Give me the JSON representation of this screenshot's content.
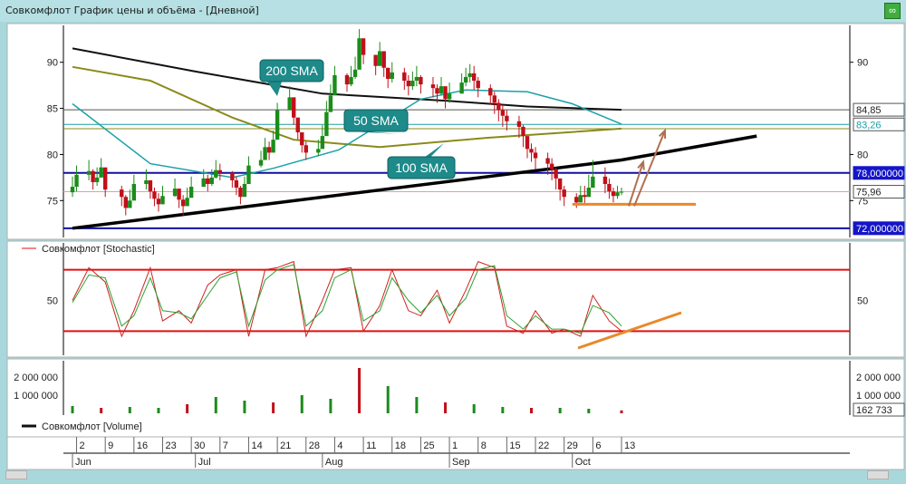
{
  "window": {
    "title": "Совкомфлот График цены и объёма - [Дневной]",
    "link_icon": "link-icon"
  },
  "colors": {
    "background": "#ffffff",
    "candle_up": "#1a8c1a",
    "candle_down": "#c0101a",
    "sma200": "#111111",
    "sma100": "#8a8a1a",
    "sma50": "#1aa0a8",
    "trend_line": "#000000",
    "level_line": "#1010a0",
    "stoch_level": "#e01010",
    "annotation": "#e8892a",
    "arrow": "#b07050",
    "callout": "#1e8a8a"
  },
  "price_panel": {
    "y_ticks": [
      "90",
      "85",
      "80",
      "75"
    ],
    "right_ticks": [
      "90",
      "80",
      "75"
    ],
    "price_tags": [
      {
        "value": "84,85",
        "style": "plain"
      },
      {
        "value": "83,26",
        "style": "teal"
      },
      {
        "value": "78,000000",
        "style": "blue"
      },
      {
        "value": "75,96",
        "style": "plain"
      },
      {
        "value": "72,000000",
        "style": "blue"
      }
    ],
    "callouts": [
      "200 SMA",
      "50 SMA",
      "100 SMA"
    ]
  },
  "stochastic_panel": {
    "legend": "Совкомфлот [Stochastic]",
    "y_ticks": [
      "50"
    ],
    "right_ticks": [
      "50"
    ]
  },
  "volume_panel": {
    "legend": "Совкомфлот [Volume]",
    "y_ticks": [
      "2 000 000",
      "1 000 000"
    ],
    "right_ticks": [
      "2 000 000",
      "1 000 000"
    ],
    "last_value": "162 733"
  },
  "time_axis": {
    "day_labels": [
      "2",
      "9",
      "16",
      "23",
      "30",
      "7",
      "14",
      "21",
      "28",
      "4",
      "11",
      "18",
      "25",
      "1",
      "8",
      "15",
      "22",
      "29",
      "6",
      "13"
    ],
    "month_labels": [
      "Jun",
      "Jul",
      "Aug",
      "Sep",
      "Oct"
    ]
  },
  "chart_data": [
    {
      "type": "candlestick",
      "panel": "price",
      "title": "Совкомфлот График цены и объёма - [Дневной]",
      "ylim": [
        71,
        94
      ],
      "x_range": [
        "2023-06-01",
        "2023-10-13"
      ],
      "series": [
        {
          "name": "200 SMA",
          "x": [
            "2023-06-01",
            "2023-07-01",
            "2023-08-01",
            "2023-09-01",
            "2023-09-20",
            "2023-10-13"
          ],
          "values": [
            91.5,
            89.0,
            86.6,
            85.8,
            85.2,
            84.85
          ]
        },
        {
          "name": "100 SMA",
          "x": [
            "2023-06-01",
            "2023-06-20",
            "2023-07-10",
            "2023-07-25",
            "2023-08-15",
            "2023-09-10",
            "2023-10-13"
          ],
          "values": [
            89.5,
            88.0,
            84.0,
            81.6,
            80.8,
            81.8,
            82.8
          ]
        },
        {
          "name": "50 SMA",
          "x": [
            "2023-06-01",
            "2023-06-20",
            "2023-07-10",
            "2023-07-20",
            "2023-08-05",
            "2023-08-25",
            "2023-09-05",
            "2023-09-20",
            "2023-10-01",
            "2023-10-13"
          ],
          "values": [
            85.5,
            79.0,
            77.5,
            78.5,
            80.5,
            86.0,
            87.0,
            86.8,
            85.5,
            83.3
          ]
        },
        {
          "name": "trend-line",
          "x": [
            "2023-06-01",
            "2023-10-13",
            "2023-11-15"
          ],
          "values": [
            72.0,
            79.4,
            82.0
          ]
        }
      ],
      "horizontal_lines": [
        78.0,
        72.0,
        84.85,
        83.26,
        82.8,
        75.96
      ],
      "ohlc": {
        "dates": [
          "2023-06-01",
          "2023-06-02",
          "2023-06-05",
          "2023-06-06",
          "2023-06-07",
          "2023-06-08",
          "2023-06-09",
          "2023-06-13",
          "2023-06-14",
          "2023-06-15",
          "2023-06-16",
          "2023-06-19",
          "2023-06-20",
          "2023-06-21",
          "2023-06-22",
          "2023-06-23",
          "2023-06-26",
          "2023-06-27",
          "2023-06-28",
          "2023-06-29",
          "2023-06-30",
          "2023-07-03",
          "2023-07-04",
          "2023-07-05",
          "2023-07-06",
          "2023-07-07",
          "2023-07-10",
          "2023-07-11",
          "2023-07-12",
          "2023-07-13",
          "2023-07-14",
          "2023-07-17",
          "2023-07-18",
          "2023-07-19",
          "2023-07-20",
          "2023-07-21",
          "2023-07-24",
          "2023-07-25",
          "2023-07-26",
          "2023-07-27",
          "2023-07-28",
          "2023-07-31",
          "2023-08-01",
          "2023-08-02",
          "2023-08-03",
          "2023-08-04",
          "2023-08-07",
          "2023-08-08",
          "2023-08-09",
          "2023-08-10",
          "2023-08-11",
          "2023-08-14",
          "2023-08-15",
          "2023-08-16",
          "2023-08-17",
          "2023-08-18",
          "2023-08-21",
          "2023-08-22",
          "2023-08-23",
          "2023-08-24",
          "2023-08-25",
          "2023-08-28",
          "2023-08-29",
          "2023-08-30",
          "2023-08-31",
          "2023-09-01",
          "2023-09-04",
          "2023-09-05",
          "2023-09-06",
          "2023-09-07",
          "2023-09-08",
          "2023-09-11",
          "2023-09-12",
          "2023-09-13",
          "2023-09-14",
          "2023-09-15",
          "2023-09-18",
          "2023-09-19",
          "2023-09-20",
          "2023-09-21",
          "2023-09-22",
          "2023-09-25",
          "2023-09-26",
          "2023-09-27",
          "2023-09-28",
          "2023-09-29",
          "2023-10-02",
          "2023-10-03",
          "2023-10-04",
          "2023-10-05",
          "2023-10-06",
          "2023-10-09",
          "2023-10-10",
          "2023-10-11",
          "2023-10-12",
          "2023-10-13"
        ],
        "close": [
          76.5,
          77.8,
          78.2,
          77.0,
          77.5,
          78.6,
          76.2,
          75.4,
          74.2,
          75.0,
          76.8,
          77.2,
          76.0,
          75.2,
          74.6,
          75.5,
          76.3,
          75.1,
          74.4,
          75.3,
          76.5,
          77.4,
          76.8,
          77.5,
          78.3,
          78.0,
          77.2,
          76.4,
          75.4,
          76.8,
          78.8,
          79.4,
          80.8,
          80.2,
          81.6,
          84.8,
          86.2,
          84.0,
          82.4,
          81.0,
          80.2,
          80.6,
          82.0,
          84.6,
          86.4,
          88.6,
          87.6,
          88.4,
          89.2,
          92.6,
          90.8,
          89.6,
          91.2,
          89.4,
          88.2,
          88.9,
          88.0,
          87.4,
          88.0,
          88.4,
          87.6,
          87.2,
          86.6,
          87.4,
          86.0,
          86.6,
          87.8,
          88.4,
          88.8,
          88.0,
          87.2,
          86.4,
          85.6,
          84.8,
          84.2,
          83.6,
          83.0,
          82.0,
          80.6,
          80.2,
          79.6,
          79.0,
          78.4,
          77.4,
          76.2,
          75.4,
          74.8,
          75.6,
          75.4,
          76.4,
          77.6,
          76.8,
          76.0,
          75.5,
          75.9,
          75.96
        ],
        "high": [
          77.6,
          78.8,
          79.4,
          78.4,
          78.6,
          79.6,
          77.6,
          76.6,
          75.6,
          76.2,
          77.8,
          78.4,
          77.2,
          76.4,
          75.8,
          76.6,
          77.4,
          76.2,
          75.6,
          76.4,
          77.6,
          78.4,
          77.8,
          78.4,
          79.4,
          79.0,
          78.2,
          77.6,
          76.6,
          77.6,
          79.8,
          80.4,
          81.8,
          81.4,
          82.6,
          85.6,
          87.4,
          85.6,
          84.0,
          82.2,
          81.4,
          81.6,
          83.2,
          85.8,
          87.6,
          89.6,
          88.8,
          89.6,
          90.6,
          93.6,
          92.2,
          90.8,
          92.2,
          90.6,
          89.4,
          90.0,
          89.4,
          88.6,
          89.0,
          89.6,
          88.6,
          88.4,
          87.6,
          88.4,
          87.2,
          87.8,
          88.8,
          89.4,
          89.8,
          89.6,
          88.4,
          87.6,
          86.8,
          86.0,
          85.4,
          84.8,
          84.2,
          83.2,
          81.8,
          81.2,
          80.8,
          80.2,
          79.6,
          78.6,
          77.4,
          76.6,
          75.8,
          76.6,
          76.6,
          77.8,
          79.4,
          78.6,
          77.4,
          76.4,
          76.6,
          76.4
        ],
        "low": [
          75.4,
          76.0,
          77.2,
          76.2,
          76.6,
          77.6,
          75.4,
          74.4,
          73.4,
          74.2,
          75.6,
          76.2,
          75.2,
          74.4,
          73.8,
          74.6,
          75.4,
          74.2,
          73.4,
          74.4,
          75.4,
          76.6,
          76.0,
          76.6,
          77.4,
          77.2,
          76.4,
          75.6,
          74.6,
          75.6,
          77.8,
          78.6,
          79.6,
          79.4,
          80.4,
          83.4,
          84.8,
          83.2,
          81.6,
          80.2,
          79.4,
          79.8,
          80.8,
          83.2,
          85.2,
          87.4,
          86.8,
          87.4,
          88.2,
          90.8,
          89.8,
          88.6,
          89.8,
          88.4,
          87.2,
          87.8,
          87.0,
          86.4,
          87.0,
          87.4,
          86.6,
          86.2,
          85.6,
          86.4,
          85.0,
          85.6,
          86.8,
          87.4,
          87.8,
          87.0,
          86.2,
          85.4,
          84.4,
          83.6,
          83.0,
          82.6,
          81.8,
          80.8,
          79.6,
          79.2,
          78.4,
          77.8,
          77.2,
          76.2,
          75.0,
          74.4,
          74.2,
          74.8,
          74.6,
          75.4,
          76.4,
          75.8,
          75.2,
          74.8,
          75.2,
          75.6
        ]
      }
    },
    {
      "type": "line",
      "panel": "stochastic",
      "ylim": [
        0,
        100
      ],
      "levels": [
        80,
        20
      ],
      "series": [
        {
          "name": "%K",
          "x": [
            "2023-06-01",
            "2023-06-05",
            "2023-06-09",
            "2023-06-13",
            "2023-06-16",
            "2023-06-20",
            "2023-06-23",
            "2023-06-27",
            "2023-06-30",
            "2023-07-04",
            "2023-07-07",
            "2023-07-11",
            "2023-07-14",
            "2023-07-18",
            "2023-07-21",
            "2023-07-25",
            "2023-07-28",
            "2023-08-01",
            "2023-08-04",
            "2023-08-08",
            "2023-08-11",
            "2023-08-15",
            "2023-08-18",
            "2023-08-22",
            "2023-08-25",
            "2023-08-29",
            "2023-09-01",
            "2023-09-05",
            "2023-09-08",
            "2023-09-12",
            "2023-09-15",
            "2023-09-19",
            "2023-09-22",
            "2023-09-26",
            "2023-09-29",
            "2023-10-03",
            "2023-10-06",
            "2023-10-10",
            "2023-10-13"
          ],
          "values": [
            50,
            82,
            68,
            15,
            40,
            82,
            30,
            40,
            28,
            65,
            75,
            80,
            15,
            80,
            82,
            88,
            15,
            50,
            80,
            82,
            20,
            45,
            80,
            40,
            35,
            60,
            28,
            60,
            88,
            82,
            25,
            18,
            40,
            18,
            22,
            15,
            55,
            30,
            20
          ]
        },
        {
          "name": "%D",
          "x": [
            "2023-06-01",
            "2023-06-05",
            "2023-06-09",
            "2023-06-13",
            "2023-06-16",
            "2023-06-20",
            "2023-06-23",
            "2023-06-27",
            "2023-06-30",
            "2023-07-04",
            "2023-07-07",
            "2023-07-11",
            "2023-07-14",
            "2023-07-18",
            "2023-07-21",
            "2023-07-25",
            "2023-07-28",
            "2023-08-01",
            "2023-08-04",
            "2023-08-08",
            "2023-08-11",
            "2023-08-15",
            "2023-08-18",
            "2023-08-22",
            "2023-08-25",
            "2023-08-29",
            "2023-09-01",
            "2023-09-05",
            "2023-09-08",
            "2023-09-12",
            "2023-09-15",
            "2023-09-19",
            "2023-09-22",
            "2023-09-26",
            "2023-09-29",
            "2023-10-03",
            "2023-10-06",
            "2023-10-10",
            "2023-10-13"
          ],
          "values": [
            48,
            75,
            72,
            25,
            35,
            72,
            40,
            38,
            32,
            55,
            72,
            78,
            25,
            70,
            80,
            85,
            25,
            40,
            72,
            80,
            30,
            40,
            72,
            50,
            38,
            55,
            35,
            52,
            80,
            84,
            35,
            22,
            35,
            22,
            22,
            18,
            45,
            38,
            25
          ]
        }
      ]
    },
    {
      "type": "bar",
      "panel": "volume",
      "ylim": [
        0,
        2600000
      ],
      "last_value": 162733,
      "x": [
        "2023-06-01",
        "2023-06-08",
        "2023-06-15",
        "2023-06-22",
        "2023-06-29",
        "2023-07-06",
        "2023-07-13",
        "2023-07-20",
        "2023-07-27",
        "2023-08-03",
        "2023-08-10",
        "2023-08-17",
        "2023-08-24",
        "2023-08-31",
        "2023-09-07",
        "2023-09-14",
        "2023-09-21",
        "2023-09-28",
        "2023-10-05",
        "2023-10-13"
      ],
      "values": [
        400000,
        300000,
        350000,
        300000,
        500000,
        900000,
        700000,
        600000,
        1000000,
        800000,
        2500000,
        1500000,
        900000,
        600000,
        500000,
        350000,
        300000,
        300000,
        250000,
        162733
      ]
    }
  ]
}
